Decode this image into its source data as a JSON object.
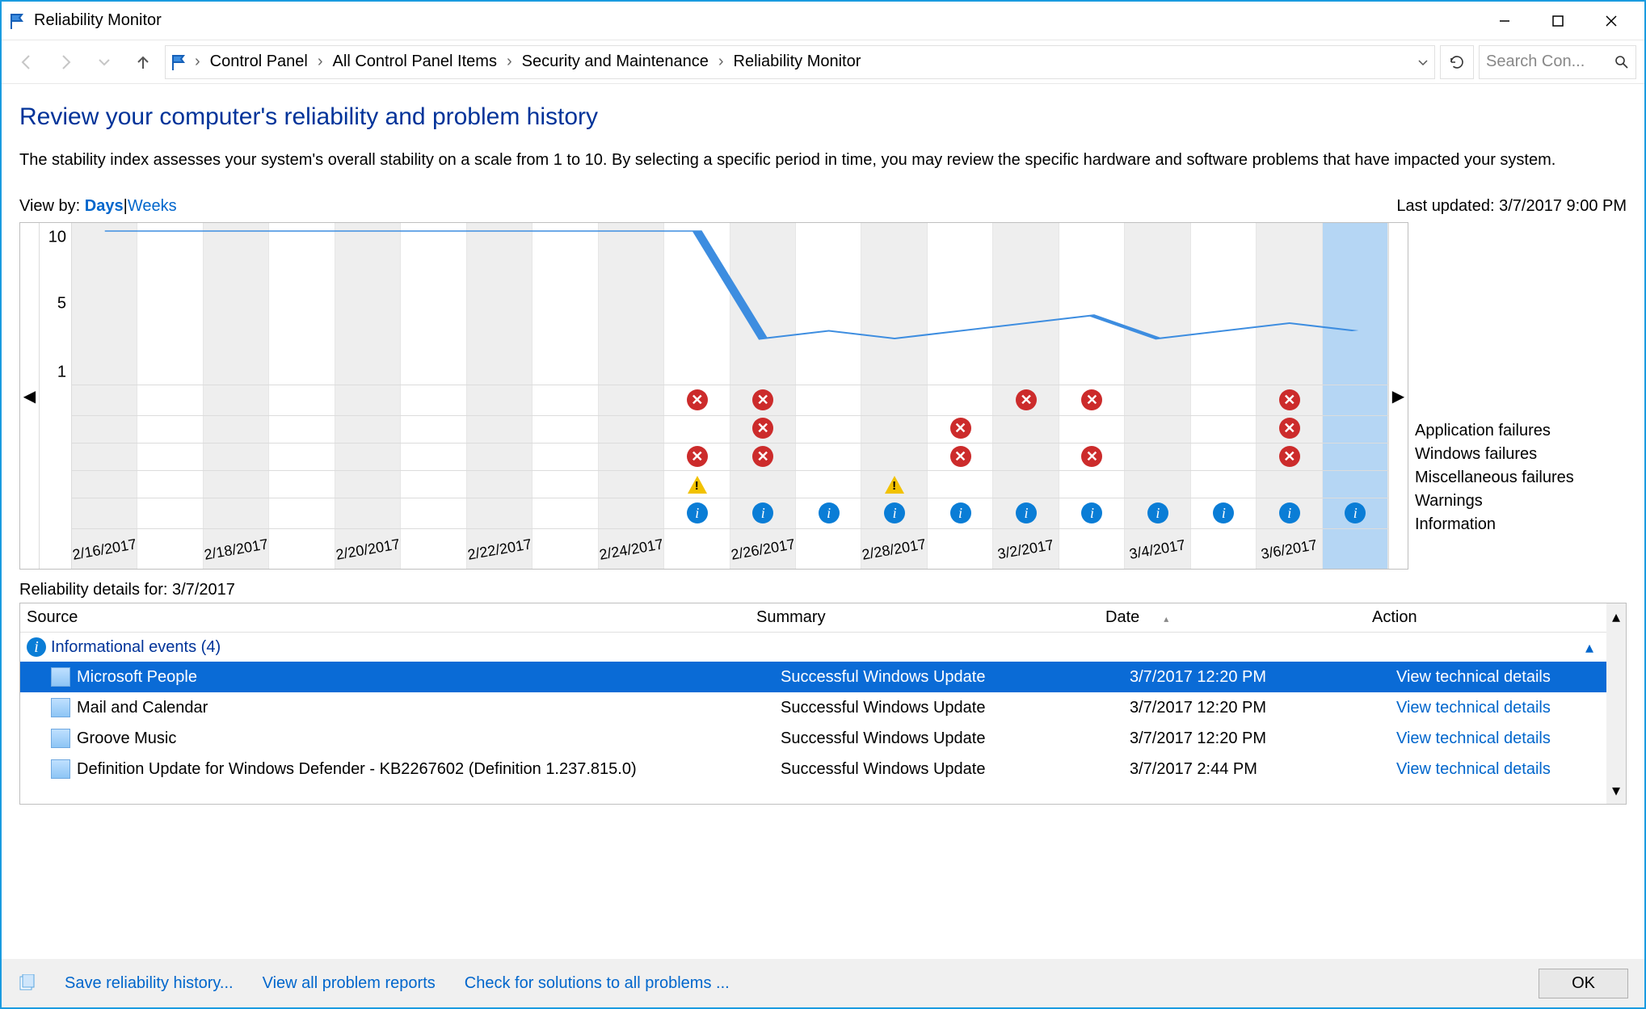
{
  "window": {
    "title": "Reliability Monitor"
  },
  "breadcrumb": {
    "items": [
      "Control Panel",
      "All Control Panel Items",
      "Security and Maintenance",
      "Reliability Monitor"
    ]
  },
  "search": {
    "placeholder": "Search Con..."
  },
  "page": {
    "title": "Review your computer's reliability and problem history",
    "description": "The stability index assesses your system's overall stability on a scale from 1 to 10. By selecting a specific period in time, you may review the specific hardware and software problems that have impacted your system."
  },
  "view": {
    "label": "View by:",
    "days": "Days",
    "weeks": "Weeks",
    "separator": " | ",
    "last_updated_label": "Last updated:",
    "last_updated_value": "3/7/2017 9:00 PM"
  },
  "chart_data": {
    "type": "reliability-timeline",
    "ylabel": "",
    "xlabel": "",
    "y_ticks": [
      "10",
      "5",
      "1"
    ],
    "dates": [
      "2/16/2017",
      "",
      "2/18/2017",
      "",
      "2/20/2017",
      "",
      "2/22/2017",
      "",
      "2/24/2017",
      "",
      "2/26/2017",
      "",
      "2/28/2017",
      "",
      "3/2/2017",
      "",
      "3/4/2017",
      "",
      "3/6/2017",
      ""
    ],
    "selected_index": 19,
    "stability": [
      10,
      10,
      10,
      10,
      10,
      10,
      10,
      10,
      10,
      10,
      3,
      3.5,
      3,
      3.5,
      4,
      4.5,
      3,
      3.5,
      4,
      3.5
    ],
    "legend": [
      "Application failures",
      "Windows failures",
      "Miscellaneous failures",
      "Warnings",
      "Information"
    ],
    "rows": {
      "app_failures": [
        0,
        0,
        0,
        0,
        0,
        0,
        0,
        0,
        0,
        1,
        1,
        0,
        0,
        0,
        1,
        1,
        0,
        0,
        1,
        0
      ],
      "win_failures": [
        0,
        0,
        0,
        0,
        0,
        0,
        0,
        0,
        0,
        0,
        1,
        0,
        0,
        1,
        0,
        0,
        0,
        0,
        1,
        0
      ],
      "misc_failures": [
        0,
        0,
        0,
        0,
        0,
        0,
        0,
        0,
        0,
        1,
        1,
        0,
        0,
        1,
        0,
        1,
        0,
        0,
        1,
        0
      ],
      "warnings": [
        0,
        0,
        0,
        0,
        0,
        0,
        0,
        0,
        0,
        1,
        0,
        0,
        1,
        0,
        0,
        0,
        0,
        0,
        0,
        0
      ],
      "information": [
        0,
        0,
        0,
        0,
        0,
        0,
        0,
        0,
        0,
        1,
        1,
        1,
        1,
        1,
        1,
        1,
        1,
        1,
        1,
        1
      ]
    }
  },
  "details": {
    "header_label": "Reliability details for:",
    "header_date": "3/7/2017",
    "columns": {
      "source": "Source",
      "summary": "Summary",
      "date": "Date",
      "action": "Action"
    },
    "group": {
      "label": "Informational events (4)"
    },
    "rows": [
      {
        "source": "Microsoft People",
        "summary": "Successful Windows Update",
        "date": "3/7/2017 12:20 PM",
        "action": "View  technical details",
        "selected": true
      },
      {
        "source": "Mail and Calendar",
        "summary": "Successful Windows Update",
        "date": "3/7/2017 12:20 PM",
        "action": "View  technical details",
        "selected": false
      },
      {
        "source": "Groove Music",
        "summary": "Successful Windows Update",
        "date": "3/7/2017 12:20 PM",
        "action": "View  technical details",
        "selected": false
      },
      {
        "source": "Definition Update for Windows Defender - KB2267602 (Definition 1.237.815.0)",
        "summary": "Successful Windows Update",
        "date": "3/7/2017 2:44 PM",
        "action": "View  technical details",
        "selected": false
      }
    ]
  },
  "footer": {
    "save": "Save reliability history...",
    "view_all": "View all problem reports",
    "check": "Check for solutions to all problems ...",
    "ok": "OK"
  }
}
